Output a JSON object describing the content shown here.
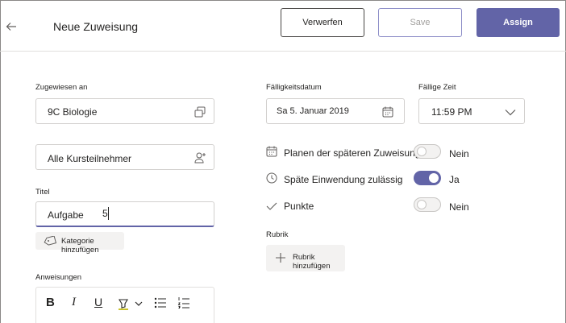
{
  "header": {
    "title": "Neue Zuweisung",
    "discard_label": "Verwerfen",
    "save_label": "Save",
    "assign_label": "Assign"
  },
  "assigned_to": {
    "label": "Zugewiesen an",
    "class_value": "9C Biologie",
    "students_value": "Alle Kursteilnehmer"
  },
  "title_field": {
    "label": "Titel",
    "value": "Aufgabe",
    "cursor_text": "5"
  },
  "category": {
    "label": "Kategorie hinzufügen"
  },
  "instructions": {
    "label": "Anweisungen"
  },
  "due": {
    "date_label": "Fälligkeitsdatum",
    "date_value": "Sa 5. Januar 2019",
    "time_label": "Fällige Zeit",
    "time_value": "11:59 PM"
  },
  "options": [
    {
      "label": "Planen der späteren Zuweisung",
      "state": "Nein",
      "on": false,
      "icon": "calendar-icon"
    },
    {
      "label": "Späte Einwendung zulässig",
      "state": "Ja",
      "on": true,
      "icon": "clock-icon"
    },
    {
      "label": "Punkte",
      "state": "Nein",
      "on": false,
      "icon": "checkmark-icon"
    }
  ],
  "rubric": {
    "label": "Rubrik",
    "add_label": "Rubrik hinzufügen"
  },
  "colors": {
    "accent": "#6264a7",
    "text": "#252423",
    "border": "#d2d0ce"
  }
}
